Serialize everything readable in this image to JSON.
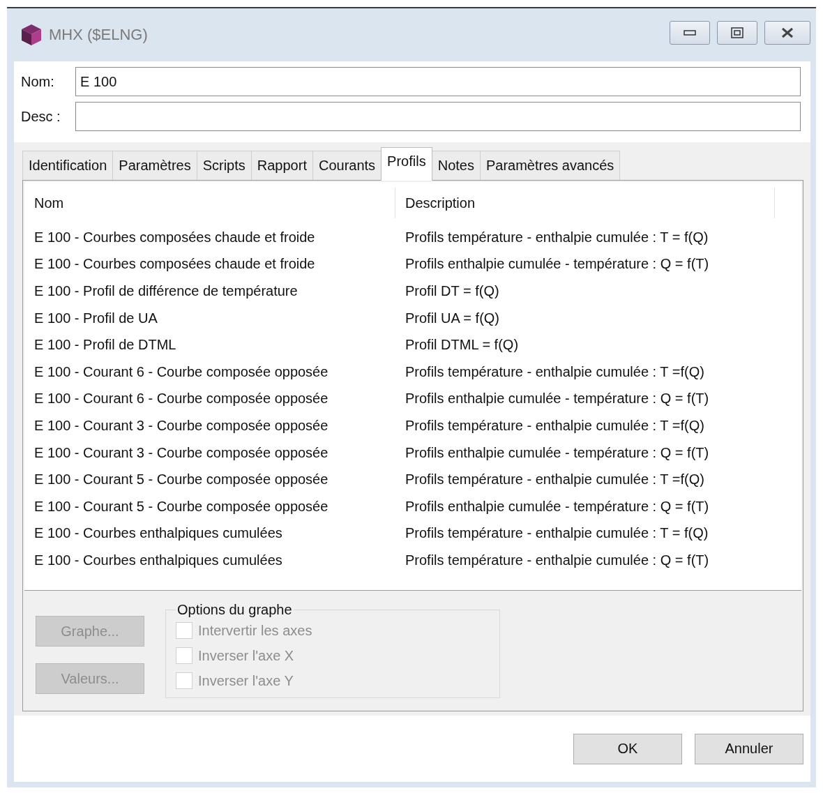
{
  "window": {
    "title": "MHX ($ELNG)"
  },
  "fields": [
    {
      "label": "Nom:",
      "value": "E 100"
    },
    {
      "label": "Desc :"
    }
  ],
  "tabs": [
    {
      "label": "Identification",
      "selected": false
    },
    {
      "label": "Paramètres",
      "selected": false
    },
    {
      "label": "Scripts",
      "selected": false
    },
    {
      "label": "Rapport",
      "selected": false
    },
    {
      "label": "Courants",
      "selected": false
    },
    {
      "label": "Profils",
      "selected": true
    },
    {
      "label": "Notes",
      "selected": false
    },
    {
      "label": "Paramètres avancés",
      "selected": false
    }
  ],
  "table": {
    "columns": [
      "Nom",
      "Description"
    ],
    "rows": [
      [
        "E 100 - Courbes composées chaude et froide",
        "Profils température - enthalpie cumulée : T = f(Q)"
      ],
      [
        "E 100 - Courbes composées chaude et froide",
        "Profils enthalpie cumulée - température : Q = f(T)"
      ],
      [
        "E 100 - Profil de différence de température",
        "Profil DT = f(Q)"
      ],
      [
        "E 100 - Profil de UA",
        "Profil UA = f(Q)"
      ],
      [
        "E 100 - Profil de DTML",
        "Profil DTML = f(Q)"
      ],
      [
        "E 100 - Courant 6 - Courbe composée opposée",
        "Profils température - enthalpie cumulée : T =f(Q)"
      ],
      [
        "E 100 - Courant 6 - Courbe composée opposée",
        "Profils enthalpie cumulée - température : Q = f(T)"
      ],
      [
        "E 100 - Courant 3 - Courbe composée opposée",
        "Profils température - enthalpie cumulée : T =f(Q)"
      ],
      [
        "E 100 - Courant 3 - Courbe composée opposée",
        "Profils enthalpie cumulée - température : Q = f(T)"
      ],
      [
        "E 100 - Courant 5 - Courbe composée opposée",
        "Profils température - enthalpie cumulée : T =f(Q)"
      ],
      [
        "E 100 - Courant 5 - Courbe composée opposée",
        "Profils enthalpie cumulée - température : Q = f(T)"
      ],
      [
        "E 100 - Courbes enthalpiques cumulées",
        "Profils température - enthalpie cumulée : T = f(Q)"
      ],
      [
        "E 100 - Courbes enthalpiques cumulées",
        "Profils température - enthalpie cumulée : Q = f(T)"
      ]
    ]
  },
  "side_buttons": [
    {
      "label": "Graphe...",
      "disabled": true
    },
    {
      "label": "Valeurs...",
      "disabled": true
    }
  ],
  "graph_options": {
    "title": "Options du graphe",
    "options": [
      {
        "label": "Intervertir les axes",
        "checked": false,
        "disabled": true
      },
      {
        "label": "Inverser l'axe X",
        "checked": false,
        "disabled": true
      },
      {
        "label": "Inverser l'axe Y",
        "checked": false,
        "disabled": true
      }
    ]
  },
  "buttons": [
    "OK",
    "Annuler"
  ]
}
